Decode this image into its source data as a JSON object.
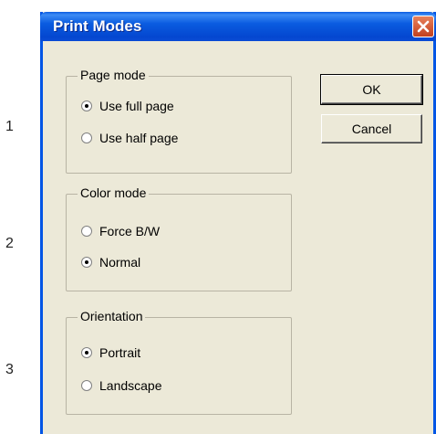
{
  "step_numbers": [
    "1",
    "2",
    "3"
  ],
  "dialog": {
    "title": "Print Modes",
    "ok_label": "OK",
    "cancel_label": "Cancel",
    "groups": [
      {
        "legend": "Page mode",
        "options": [
          {
            "label": "Use full page",
            "checked": true
          },
          {
            "label": "Use half page",
            "checked": false
          }
        ]
      },
      {
        "legend": "Color mode",
        "options": [
          {
            "label": "Force B/W",
            "checked": false
          },
          {
            "label": "Normal",
            "checked": true
          }
        ]
      },
      {
        "legend": "Orientation",
        "options": [
          {
            "label": "Portrait",
            "checked": true
          },
          {
            "label": "Landscape",
            "checked": false
          }
        ]
      }
    ]
  },
  "colors": {
    "titlebar": "#0a5ce0",
    "dialog_bg": "#ece9d8",
    "close_button": "#d4532c"
  },
  "icons": {
    "close": "close-icon"
  }
}
